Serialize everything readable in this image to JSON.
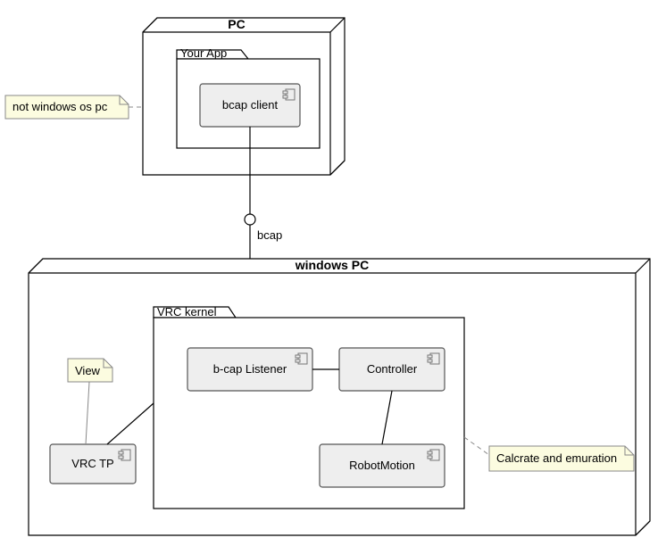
{
  "nodes": {
    "pc": {
      "title": "PC"
    },
    "windows_pc": {
      "title": "windows PC"
    }
  },
  "packages": {
    "your_app": {
      "title": "Your App"
    },
    "vrc_kernel": {
      "title": "VRC kernel"
    }
  },
  "components": {
    "bcap_client": {
      "label": "bcap client"
    },
    "bcap_listener": {
      "label": "b-cap Listener"
    },
    "controller": {
      "label": "Controller"
    },
    "robot_motion": {
      "label": "RobotMotion"
    },
    "vrc_tp": {
      "label": "VRC TP"
    }
  },
  "notes": {
    "not_windows": {
      "text": "not windows os pc"
    },
    "view": {
      "text": "View"
    },
    "calc": {
      "text": "Calcrate and emuration"
    }
  },
  "labels": {
    "bcap_interface": "bcap"
  },
  "chart_data": {
    "type": "uml-deployment",
    "nodes": [
      {
        "id": "PC",
        "stereotype": "node",
        "note": "not windows os pc",
        "children": [
          {
            "id": "Your App",
            "stereotype": "package",
            "children": [
              {
                "id": "bcap client",
                "stereotype": "component"
              }
            ]
          }
        ]
      },
      {
        "id": "windows PC",
        "stereotype": "node",
        "children": [
          {
            "id": "VRC TP",
            "stereotype": "component",
            "note": "View"
          },
          {
            "id": "VRC kernel",
            "stereotype": "package",
            "note": "Calcrate and emuration",
            "children": [
              {
                "id": "b-cap Listener",
                "stereotype": "component"
              },
              {
                "id": "Controller",
                "stereotype": "component"
              },
              {
                "id": "RobotMotion",
                "stereotype": "component"
              }
            ]
          }
        ]
      }
    ],
    "edges": [
      {
        "from": "bcap client",
        "to": "b-cap Listener",
        "via_interface": "bcap",
        "type": "lollipop"
      },
      {
        "from": "b-cap Listener",
        "to": "Controller",
        "type": "assoc"
      },
      {
        "from": "Controller",
        "to": "RobotMotion",
        "type": "assoc"
      },
      {
        "from": "VRC TP",
        "to": "VRC kernel",
        "type": "assoc"
      }
    ]
  }
}
